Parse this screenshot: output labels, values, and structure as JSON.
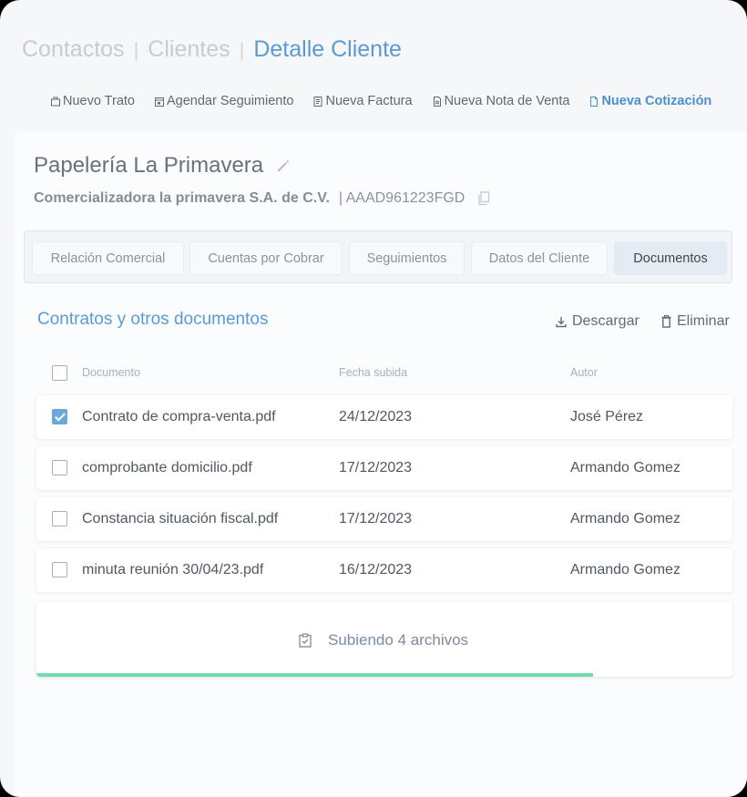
{
  "breadcrumb": {
    "items": [
      "Contactos",
      "Clientes",
      "Detalle Cliente"
    ],
    "separator": "|"
  },
  "actions": [
    {
      "label": "Nuevo Trato",
      "icon": "briefcase-icon"
    },
    {
      "label": "Agendar Seguimiento",
      "icon": "calendar-icon"
    },
    {
      "label": "Nueva Factura",
      "icon": "invoice-icon"
    },
    {
      "label": "Nueva Nota de Venta",
      "icon": "note-icon"
    },
    {
      "label": "Nueva Cotización",
      "icon": "document-icon",
      "active": true
    }
  ],
  "client": {
    "name": "Papelería La Primavera",
    "legal_name": "Comercializadora la primavera S.A. de C.V.",
    "rfc": "| AAAD961223FGD"
  },
  "tabs": [
    {
      "label": "Relación Comercial"
    },
    {
      "label": "Cuentas por Cobrar"
    },
    {
      "label": "Seguimientos"
    },
    {
      "label": "Datos del Cliente"
    },
    {
      "label": "Documentos",
      "active": true
    }
  ],
  "documents": {
    "title": "Contratos y otros documentos",
    "download_label": "Descargar",
    "delete_label": "Eliminar",
    "columns": {
      "document": "Documento",
      "date": "Fecha subida",
      "author": "Autor"
    },
    "rows": [
      {
        "name": "Contrato de compra-venta.pdf",
        "date": "24/12/2023",
        "author": "José Pérez",
        "checked": true
      },
      {
        "name": "comprobante domicilio.pdf",
        "date": "17/12/2023",
        "author": "Armando Gomez",
        "checked": false
      },
      {
        "name": "Constancia situación fiscal.pdf",
        "date": "17/12/2023",
        "author": "Armando Gomez",
        "checked": false
      },
      {
        "name": "minuta reunión 30/04/23.pdf",
        "date": "16/12/2023",
        "author": "Armando Gomez",
        "checked": false
      }
    ]
  },
  "upload": {
    "label": "Subiendo 4 archivos",
    "progress": 0.8,
    "progress_color": "#75d9b1"
  },
  "colors": {
    "accent": "#5b9bd5",
    "checkbox_checked": "#6aa8dc"
  }
}
